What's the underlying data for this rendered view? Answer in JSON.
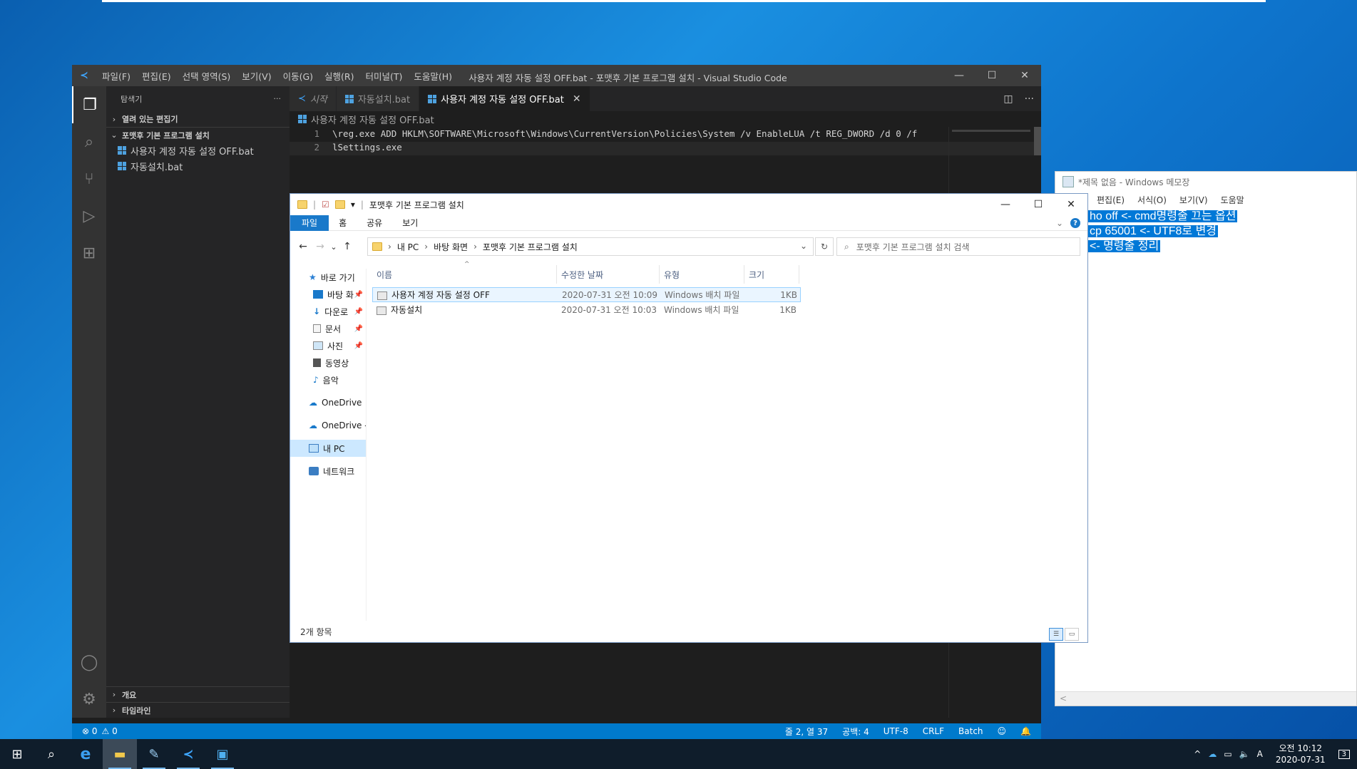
{
  "notepad": {
    "title": "*제목 없음 - Windows 메모장",
    "menu": [
      "편집(E)",
      "서식(O)",
      "보기(V)",
      "도움말"
    ],
    "lines": [
      "ho off <- cmd명령줄 끄는 옵션",
      "cp 65001 <- UTF8로 변경",
      "<- 명령줄 정리"
    ],
    "scroll_left": "<"
  },
  "vscode": {
    "logo": "≺",
    "menu": [
      "파일(F)",
      "편집(E)",
      "선택 영역(S)",
      "보기(V)",
      "이동(G)",
      "실행(R)",
      "터미널(T)",
      "도움말(H)"
    ],
    "window_title": "사용자 계정 자동 설정 OFF.bat - 포맷후 기본 프로그램 설치 - Visual Studio Code",
    "window_buttons": {
      "minimize": "—",
      "maximize": "☐",
      "close": "✕"
    },
    "activity": {
      "explorer": "❐",
      "search": "⌕",
      "scm": "⑂",
      "run": "▷",
      "extensions": "⊞",
      "account": "◯",
      "settings": "⚙"
    },
    "sidebar": {
      "header": "탐색기",
      "more": "···",
      "open_editors": "열려 있는 편집기",
      "folder": "포맷후 기본 프로그램 설치",
      "files": [
        "사용자 계정 자동 설정 OFF.bat",
        "자동설치.bat"
      ],
      "outline": "개요",
      "timeline": "타임라인",
      "chev_right": "›",
      "chev_down": "⌄"
    },
    "tabs": [
      {
        "label": "시작"
      },
      {
        "label": "자동설치.bat"
      },
      {
        "label": "사용자 계정 자동 설정 OFF.bat",
        "close": "✕"
      }
    ],
    "tab_actions": {
      "split": "◫",
      "more": "···"
    },
    "breadcrumb": "사용자 계정 자동 설정 OFF.bat",
    "code_lines": [
      {
        "num": "1",
        "text": "\\reg.exe ADD HKLM\\SOFTWARE\\Microsoft\\Windows\\CurrentVersion\\Policies\\System /v EnableLUA /t REG_DWORD /d 0 /f"
      },
      {
        "num": "2",
        "text": "lSettings.exe"
      }
    ],
    "status": {
      "errors": "⊗ 0",
      "warnings": "⚠ 0",
      "position": "줄 2, 열 37",
      "spaces": "공백: 4",
      "encoding": "UTF-8",
      "eol": "CRLF",
      "language": "Batch",
      "feedback": "☺",
      "bell": "🔔"
    }
  },
  "explorer": {
    "title": "포맷후 기본 프로그램 설치",
    "qa_sep": "|",
    "qa_check": "☑",
    "qa_drop": "▾",
    "window_buttons": {
      "minimize": "—",
      "maximize": "☐",
      "close": "✕"
    },
    "ribbon_tabs": [
      "파일",
      "홈",
      "공유",
      "보기"
    ],
    "ribbon_expand": "⌄",
    "help": "?",
    "nav": {
      "back": "←",
      "forward": "→",
      "recent": "⌄",
      "up": "↑"
    },
    "address": [
      "내 PC",
      "바탕 화면",
      "포맷후 기본 프로그램 설치"
    ],
    "addr_sep": "›",
    "addr_drop": "⌄",
    "refresh": "↻",
    "search_icon": "⌕",
    "search_placeholder": "포맷후 기본 프로그램 설치 검색",
    "nav_pane": {
      "quick_access": "바로 가기",
      "desktop": "바탕 화",
      "downloads": "다운로",
      "documents": "문서",
      "pictures": "사진",
      "videos": "동영상",
      "music": "음악",
      "onedrive1": "OneDrive",
      "onedrive2": "OneDrive -",
      "this_pc": "내 PC",
      "network": "네트워크",
      "pin": "📌"
    },
    "columns": {
      "name": "이름",
      "modified": "수정한 날짜",
      "type": "유형",
      "size": "크기"
    },
    "sort_arrow": "^",
    "files": [
      {
        "name": "사용자 계정 자동 설정 OFF",
        "modified": "2020-07-31 오전 10:09",
        "type": "Windows 배치 파일",
        "size": "1KB"
      },
      {
        "name": "자동설치",
        "modified": "2020-07-31 오전 10:03",
        "type": "Windows 배치 파일",
        "size": "1KB"
      }
    ],
    "status": "2개 항목",
    "view_details": "☰",
    "view_icons": "▭"
  },
  "taskbar": {
    "start": "⊞",
    "search": "⌕",
    "edge": "e",
    "explorer": "▬",
    "notepad": "✎",
    "vscode": "≺",
    "app5": "▣",
    "tray": {
      "chevron": "^",
      "cloud": "☁",
      "network": "▭",
      "volume": "🔈",
      "ime": "A"
    },
    "time": "오전 10:12",
    "date": "2020-07-31",
    "notification": "3"
  }
}
